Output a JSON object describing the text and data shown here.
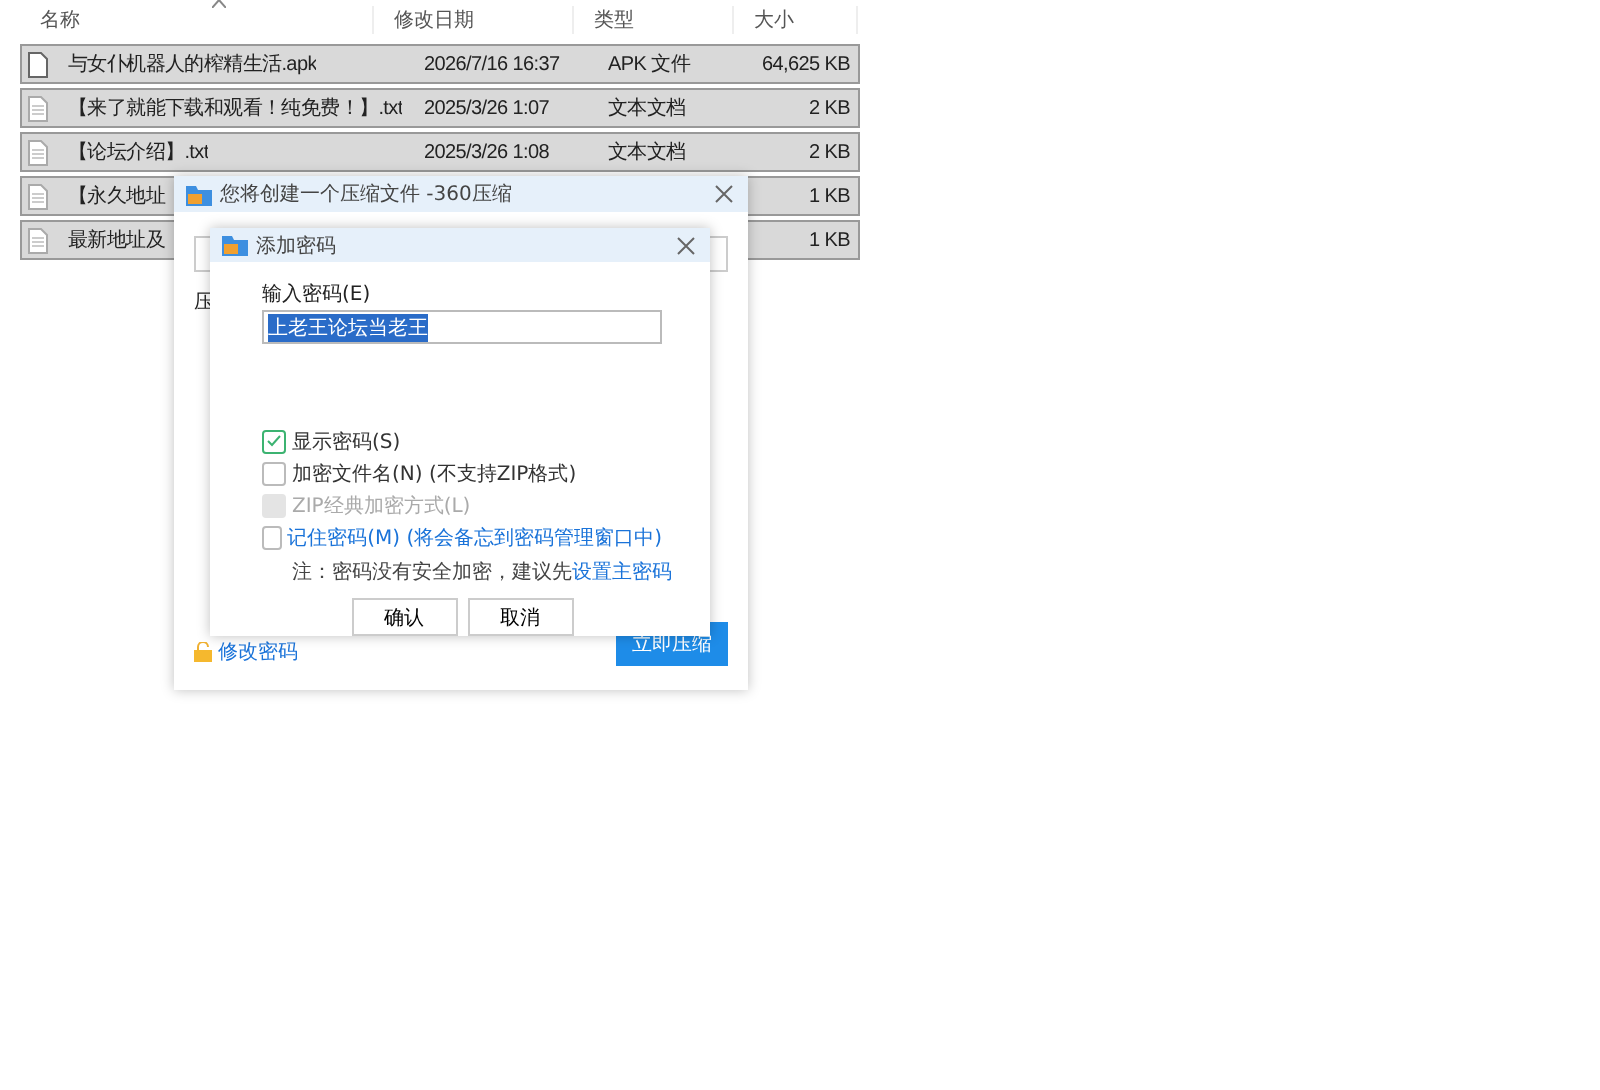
{
  "file_list": {
    "columns": [
      "名称",
      "修改日期",
      "类型",
      "大小"
    ],
    "rows": [
      {
        "name": "与女仆机器人的榨精生活.apk",
        "date": "2026/7/16 16:37",
        "type": "APK 文件",
        "size": "64,625 KB",
        "kind": "apk",
        "selected": true
      },
      {
        "name": "【来了就能下载和观看！纯免费！】.txt",
        "date": "2025/3/26 1:07",
        "type": "文本文档",
        "size": "2 KB",
        "kind": "txt",
        "selected": true
      },
      {
        "name": "【论坛介绍】.txt",
        "date": "2025/3/26 1:08",
        "type": "文本文档",
        "size": "2 KB",
        "kind": "txt",
        "selected": true
      },
      {
        "name": "【永久地址",
        "size": "1 KB",
        "kind": "txt",
        "selected": true
      },
      {
        "name": "最新地址及",
        "size": "1 KB",
        "kind": "txt",
        "selected": true
      }
    ]
  },
  "compress_dialog": {
    "title": "您将创建一个压缩文件 -360压缩",
    "label": "压",
    "change_password": "修改密码",
    "compress_button": "立即压缩"
  },
  "password_dialog": {
    "title": "添加密码",
    "input_label": "输入密码(E)",
    "password": "上老王论坛当老王",
    "password_selected": true,
    "options": [
      {
        "label": "显示密码(S)",
        "checked": true,
        "disabled": false,
        "link": false
      },
      {
        "label": "加密文件名(N) (不支持ZIP格式)",
        "checked": false,
        "disabled": false,
        "link": false
      },
      {
        "label": "ZIP经典加密方式(L)",
        "checked": false,
        "disabled": true,
        "link": false
      },
      {
        "label": "记住密码(M) (将会备忘到密码管理窗口中)",
        "checked": false,
        "disabled": false,
        "link": true
      }
    ],
    "note": "注：密码没有安全加密，建议先",
    "note_link": "设置主密码",
    "buttons": [
      "确认",
      "取消"
    ]
  }
}
